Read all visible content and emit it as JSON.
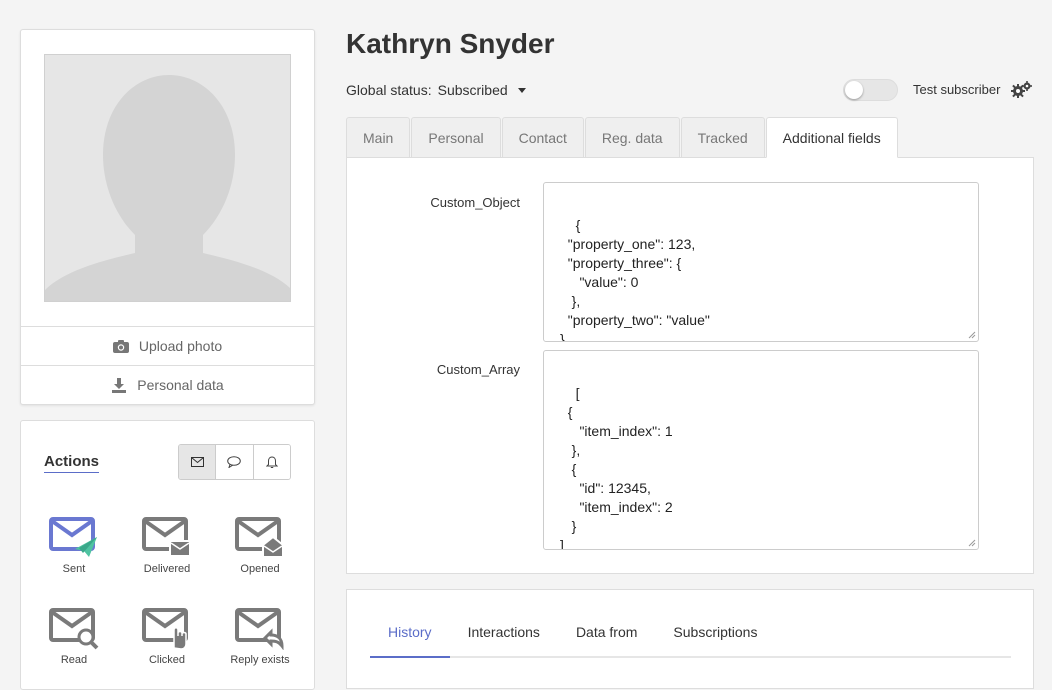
{
  "profile": {
    "name": "Kathryn Snyder",
    "upload_photo": "Upload photo",
    "personal_data": "Personal data"
  },
  "status": {
    "label": "Global status:",
    "value": "Subscribed",
    "test_subscriber": "Test subscriber",
    "test_subscriber_on": false
  },
  "tabs": [
    "Main",
    "Personal",
    "Contact",
    "Reg. data",
    "Tracked",
    "Additional fields"
  ],
  "active_tab": "Additional fields",
  "fields": {
    "custom_object": {
      "label": "Custom_Object",
      "value": "{\n  \"property_one\": 123,\n  \"property_three\": {\n     \"value\": 0\n   },\n  \"property_two\": \"value\"\n}"
    },
    "custom_array": {
      "label": "Custom_Array",
      "value": "[\n  {\n     \"item_index\": 1\n   },\n   {\n     \"id\": 12345,\n     \"item_index\": 2\n   }\n]"
    }
  },
  "actions": {
    "title": "Actions",
    "items": [
      "Sent",
      "Delivered",
      "Opened",
      "Read",
      "Clicked",
      "Reply exists"
    ]
  },
  "history": {
    "tabs": [
      "History",
      "Interactions",
      "Data from",
      "Subscriptions"
    ],
    "active": "History"
  },
  "colors": {
    "accent": "#5b6dc8",
    "sent_icon": "#6a78d1",
    "sent_plane": "#4fc3a1",
    "icon_gray": "#7a7a7a"
  }
}
